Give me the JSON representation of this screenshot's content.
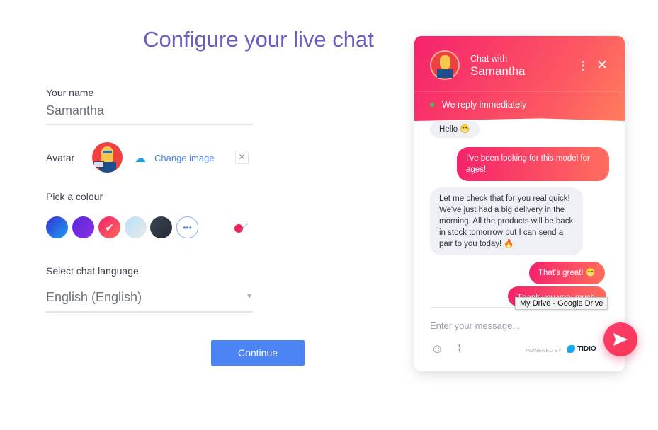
{
  "page": {
    "title": "Configure your live chat"
  },
  "form": {
    "name_label": "Your name",
    "name_value": "Samantha",
    "avatar_label": "Avatar",
    "change_image": "Change image",
    "colour_label": "Pick a colour",
    "colours": [
      "#2a5ce8",
      "#7a2ee0",
      "#f73d62",
      "#c9e6f5",
      "#2d3440"
    ],
    "selected_colour": "#f73d62",
    "language_label": "Select chat language",
    "language_value": "English (English)",
    "continue": "Continue"
  },
  "chat": {
    "chat_with": "Chat with",
    "agent": "Samantha",
    "status": "We reply immediately",
    "messages": [
      {
        "from": "agent",
        "text": "Hello 😁"
      },
      {
        "from": "user",
        "text": "I've been looking for this model for ages!"
      },
      {
        "from": "agent",
        "text": "Let me check that for you real quick! We've just had a big delivery in the morning. All the products will be back in stock tomorrow but I can send a pair to you today! 🔥"
      },
      {
        "from": "user",
        "text": "That's great! 😁"
      },
      {
        "from": "user",
        "text": "Thank you very much!"
      }
    ],
    "input_placeholder": "Enter your message...",
    "powered_by": "POWERED BY",
    "brand": "TIDIO"
  },
  "tooltip": "My Drive - Google Drive"
}
